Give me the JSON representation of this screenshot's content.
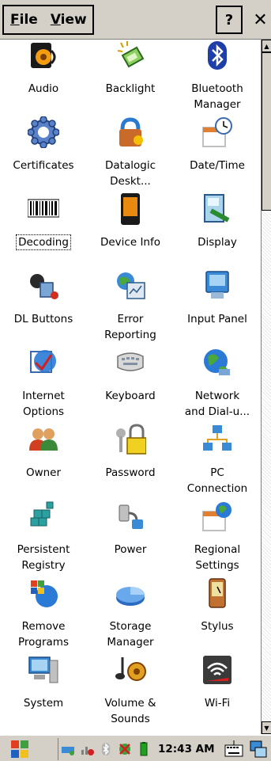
{
  "menu": {
    "file": "File",
    "file_accel": "F",
    "view": "View",
    "view_accel": "V",
    "help": "?",
    "close": "✕"
  },
  "items": [
    {
      "label": "Audio",
      "icon": "audio-icon"
    },
    {
      "label": "Backlight",
      "icon": "backlight-icon"
    },
    {
      "label": "Bluetooth\nManager",
      "icon": "bluetooth-icon"
    },
    {
      "label": "Certificates",
      "icon": "certificates-icon"
    },
    {
      "label": "Datalogic\nDeskt...",
      "icon": "datalogic-desktop-icon"
    },
    {
      "label": "Date/Time",
      "icon": "calendar-clock-icon"
    },
    {
      "label": "Decoding",
      "icon": "barcode-icon"
    },
    {
      "label": "Device Info",
      "icon": "device-info-icon"
    },
    {
      "label": "Display",
      "icon": "display-icon"
    },
    {
      "label": "DL Buttons",
      "icon": "dl-buttons-icon"
    },
    {
      "label": "Error\nReporting",
      "icon": "error-reporting-icon"
    },
    {
      "label": "Input Panel",
      "icon": "input-panel-icon"
    },
    {
      "label": "Internet\nOptions",
      "icon": "internet-options-icon"
    },
    {
      "label": "Keyboard",
      "icon": "keyboard-icon"
    },
    {
      "label": "Network\nand Dial-u...",
      "icon": "network-globe-icon"
    },
    {
      "label": "Owner",
      "icon": "owner-icon"
    },
    {
      "label": "Password",
      "icon": "password-lock-icon"
    },
    {
      "label": "PC\nConnection",
      "icon": "pc-connection-icon"
    },
    {
      "label": "Persistent\nRegistry",
      "icon": "registry-blocks-icon"
    },
    {
      "label": "Power",
      "icon": "power-plug-icon"
    },
    {
      "label": "Regional\nSettings",
      "icon": "regional-globe-icon"
    },
    {
      "label": "Remove\nPrograms",
      "icon": "remove-programs-icon"
    },
    {
      "label": "Storage\nManager",
      "icon": "storage-pie-icon"
    },
    {
      "label": "Stylus",
      "icon": "stylus-device-icon"
    },
    {
      "label": "System",
      "icon": "system-computer-icon"
    },
    {
      "label": "Volume &\nSounds",
      "icon": "volume-sounds-icon"
    },
    {
      "label": "Wi-Fi",
      "icon": "wifi-icon"
    }
  ],
  "taskbar": {
    "clock": "12:43 AM"
  }
}
